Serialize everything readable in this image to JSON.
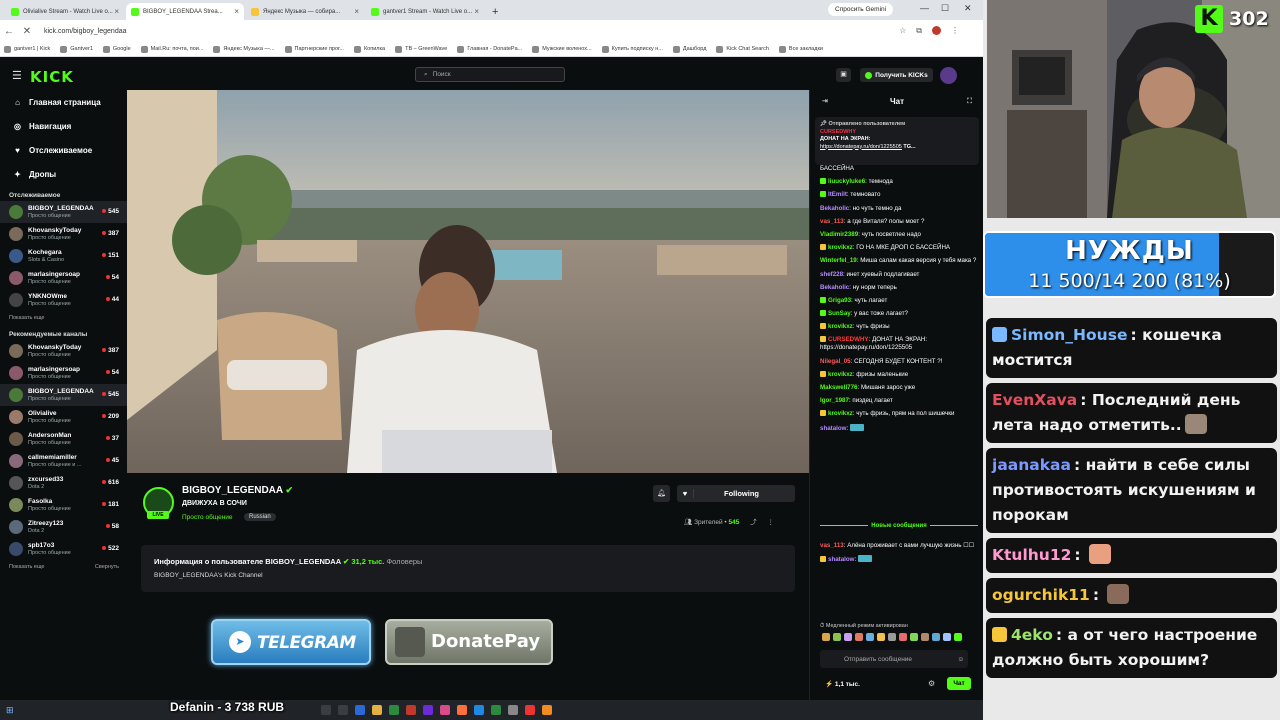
{
  "browser": {
    "tabs": [
      {
        "label": "Olivialive Stream - Watch Live o...",
        "color": "#53fc18",
        "active": false
      },
      {
        "label": "BIGBOY_LEGENDAA Strea...",
        "color": "#53fc18",
        "active": true
      },
      {
        "label": "Яндекс Музыка — собира...",
        "color": "#f5c53a",
        "active": false
      },
      {
        "label": "gantver1 Stream - Watch Live o...",
        "color": "#53fc18",
        "active": false
      }
    ],
    "gemini_label": "Спросить Gemini",
    "url": "kick.com/bigboy_legendaa",
    "bookmarks": [
      "gantver1 | Kick",
      "Gantver1",
      "Google",
      "Mail.Ru: почта, пои...",
      "Яндекс Музыка —...",
      "Партнерские прог...",
      "Копилка",
      "TB – GreenWave",
      "Главная - DonatePa...",
      "Мужские воленох...",
      "Купить подписку н...",
      "Дашборд",
      "Kick Chat Search",
      "Все закладки"
    ]
  },
  "kick": {
    "logo": "KICK",
    "search_placeholder": "Поиск",
    "get_kicks": "Получить KICKs"
  },
  "sidebar": {
    "nav": [
      {
        "label": "Главная страница",
        "icon": "home-icon"
      },
      {
        "label": "Навигация",
        "icon": "compass-icon"
      },
      {
        "label": "Отслеживаемое",
        "icon": "heart-icon"
      },
      {
        "label": "Дропы",
        "icon": "gift-icon"
      }
    ],
    "following_header": "Отслеживаемое",
    "following": [
      {
        "name": "BIGBOY_LEGENDAA",
        "sub": "Просто общение",
        "count": "545",
        "active": true,
        "color": "#4a7a3a"
      },
      {
        "name": "KhovanskyToday",
        "sub": "Просто общение",
        "count": "387",
        "active": false,
        "color": "#7a6a5a"
      },
      {
        "name": "Kochegara",
        "sub": "Slots & Casino",
        "count": "151",
        "active": false,
        "color": "#3a5a8a"
      },
      {
        "name": "marlasingersoap",
        "sub": "Просто общение",
        "count": "54",
        "active": false,
        "color": "#8a5a6a"
      },
      {
        "name": "YNKNOWme",
        "sub": "Просто общение",
        "count": "44",
        "active": false,
        "color": "#444"
      }
    ],
    "show_more": "Показать еще",
    "recommended_header": "Рекомендуемые каналы",
    "recommended": [
      {
        "name": "KhovanskyToday",
        "sub": "Просто общение",
        "count": "387",
        "active": false,
        "color": "#7a6a5a"
      },
      {
        "name": "marlasingersoap",
        "sub": "Просто общение",
        "count": "54",
        "active": false,
        "color": "#8a5a6a"
      },
      {
        "name": "BIGBOY_LEGENDAA",
        "sub": "Просто общение",
        "count": "545",
        "active": true,
        "color": "#4a7a3a"
      },
      {
        "name": "Olivialive",
        "sub": "Просто общение",
        "count": "209",
        "active": false,
        "color": "#9a7a6a"
      },
      {
        "name": "AndersonMan",
        "sub": "Просто общение",
        "count": "37",
        "active": false,
        "color": "#6a5a4a"
      },
      {
        "name": "callmemiamiller",
        "sub": "Просто общение и ...",
        "count": "45",
        "active": false,
        "color": "#8a6a7a"
      },
      {
        "name": "zxcursed33",
        "sub": "Dota 2",
        "count": "616",
        "active": false,
        "color": "#555"
      },
      {
        "name": "Fasolka",
        "sub": "Просто общение",
        "count": "181",
        "active": false,
        "color": "#7a8a5a"
      },
      {
        "name": "Zitreezy123",
        "sub": "Dota 2",
        "count": "58",
        "active": false,
        "color": "#5a6a7a"
      },
      {
        "name": "spb17o3",
        "sub": "Просто общение",
        "count": "522",
        "active": false,
        "color": "#3a4a6a"
      }
    ],
    "show_more2": "Показать еще",
    "collapse": "Свернуть"
  },
  "stream": {
    "name": "BIGBOY_LEGENDAA",
    "title": "ДВИЖУХА В СОЧИ",
    "category": "Просто общение",
    "language": "Russian",
    "live_badge": "LIVE",
    "follow_label": "Following",
    "viewers_label": "Зрителей •",
    "viewers_count": "545",
    "about_prefix": "Информация о пользователе BIGBOY_LEGENDAA",
    "followers_count": "31,2 тыс.",
    "followers_label": "Фоловеры",
    "about_desc": "BIGBOY_LEGENDAA's Kick Channel",
    "panel_telegram": "TELEGRAM",
    "panel_donate": "DonatePay"
  },
  "chat": {
    "header": "Чат",
    "pinned_by": "Отправлено пользователем",
    "pinned_user": "CURSEDWHY",
    "pinned_text": "ДОНАТ НА ЭКРАН:",
    "pinned_link": "https://donatepay.ru/don/1225505",
    "pinned_tail": "ТG...",
    "messages": [
      {
        "user": "",
        "text": "БАССЕЙНА",
        "color": "#fff",
        "badge": ""
      },
      {
        "user": "liuuckyluke6",
        "text": "темнода",
        "color": "#53fc18",
        "badge": "g"
      },
      {
        "user": "ltEmilt",
        "text": "темновато",
        "color": "#b58cff",
        "badge": "g"
      },
      {
        "user": "Bekaholic",
        "text": "но чуть темно да",
        "color": "#b58cff",
        "badge": ""
      },
      {
        "user": "vas_113",
        "text": "а где Виталя? полы моет ?",
        "color": "#ff5a5a",
        "badge": ""
      },
      {
        "user": "Vladimir2389",
        "text": "чуть посветлее надо",
        "color": "#53fc18",
        "badge": ""
      },
      {
        "user": "krovikxz",
        "text": "ГО НА МКЕ ДРОП С БАССЕЙНА",
        "color": "#53fc18",
        "badge": "y"
      },
      {
        "user": "Winterfel_19",
        "text": "Миша салам какая версия у тебя макa ?",
        "color": "#53fc18",
        "badge": ""
      },
      {
        "user": "shef228",
        "text": "инет хуевый подлагивает",
        "color": "#b58cff",
        "badge": ""
      },
      {
        "user": "Bekaholic",
        "text": "ну норм теперь",
        "color": "#b58cff",
        "badge": ""
      },
      {
        "user": "Griga93",
        "text": "чуть лагает",
        "color": "#53fc18",
        "badge": "g"
      },
      {
        "user": "SunSay",
        "text": "у вас тоже лагает?",
        "color": "#53fc18",
        "badge": "g"
      },
      {
        "user": "krovikxz",
        "text": "чуть фризы",
        "color": "#53fc18",
        "badge": "y"
      },
      {
        "user": "CURSEDWHY",
        "text": "ДОНАТ НА ЭКРАН: https://donatepay.ru/don/1225505",
        "color": "#ff3b3b",
        "badge": "y"
      },
      {
        "user": "Nilegal_05",
        "text": "СЕГОДНЯ БУДЕТ КОНТЕНТ ?!",
        "color": "#ff5a5a",
        "badge": ""
      },
      {
        "user": "krovikxz",
        "text": "фризы маленькие",
        "color": "#53fc18",
        "badge": "y"
      },
      {
        "user": "Makswell776",
        "text": "Мишаня зарос уже",
        "color": "#53fc18",
        "badge": ""
      },
      {
        "user": "Igor_1987",
        "text": "пиздец лагает",
        "color": "#53fc18",
        "badge": ""
      },
      {
        "user": "krovikxz",
        "text": "чуть фризь, прям на пол шишечки",
        "color": "#53fc18",
        "badge": "y"
      },
      {
        "user": "shatalow",
        "text": "",
        "color": "#b58cff",
        "badge": ""
      }
    ],
    "new_messages": "Новые сообщения",
    "messages2": [
      {
        "user": "vas_113",
        "text": "Алёна проживает с вами лучшую жизнь ☐☐",
        "color": "#ff5a5a",
        "badge": ""
      },
      {
        "user": "shatalow",
        "text": "",
        "color": "#b58cff",
        "badge": "y"
      }
    ],
    "slow_mode": "Медленный режим активирован",
    "send_placeholder": "Отправить сообщение",
    "kicks_count": "1,1 тыс.",
    "chat_button": "Чат"
  },
  "taskbar": {
    "ticker": "Defanin - 3 738 RUB"
  },
  "overlay": {
    "kick_count": "302",
    "goal_title": "НУЖДЫ",
    "goal_progress": "11 500/14 200 (81%)",
    "goal_fraction": 0.81,
    "chat": [
      {
        "user": "Simon_House",
        "text": "кошечка мостится",
        "color": "#7ab8ff",
        "badge": "#7ab8ff",
        "emote": ""
      },
      {
        "user": "EvenXava",
        "text": "Последний день лета надо отметить..",
        "color": "#e05060",
        "badge": "",
        "emote": "#998877"
      },
      {
        "user": "jaanakaa",
        "text": "найти в себе силы противостоять искушениям и порокам",
        "color": "#7a9aff",
        "badge": "",
        "emote": ""
      },
      {
        "user": "Ktulhu12",
        "text": "",
        "color": "#ff9ad0",
        "badge": "",
        "emote": "#e8a080"
      },
      {
        "user": "ogurchik11",
        "text": "",
        "color": "#f5c53a",
        "badge": "",
        "emote": "#8a6a5a"
      },
      {
        "user": "4eko",
        "text": "а от чего настроение должно быть хорошим?",
        "color": "#9be36b",
        "badge": "#f5c53a",
        "emote": ""
      }
    ]
  }
}
